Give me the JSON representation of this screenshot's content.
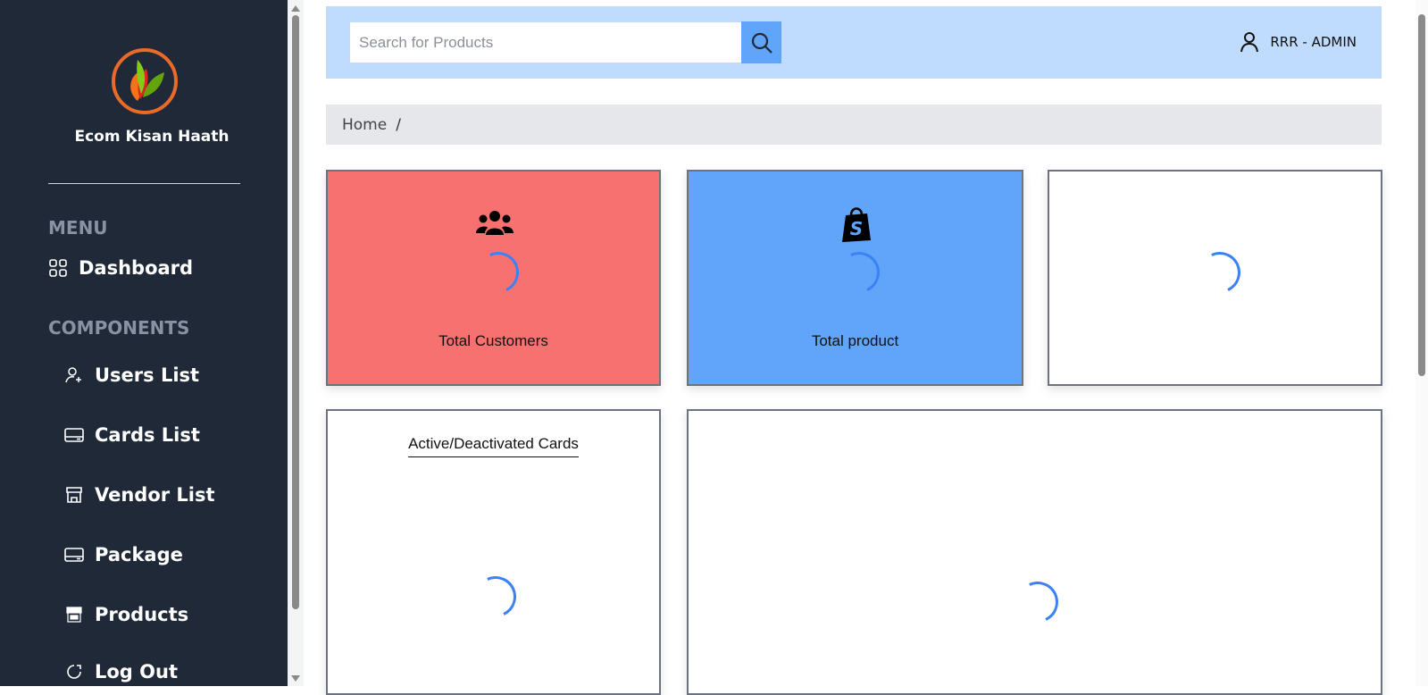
{
  "sidebar": {
    "brand": "Ecom Kisan Haath",
    "menu_label": "MENU",
    "components_label": "COMPONENTS",
    "items": [
      {
        "label": "Dashboard",
        "icon": "grid-icon"
      },
      {
        "label": "Users List",
        "icon": "user-add-icon"
      },
      {
        "label": "Cards List",
        "icon": "card-icon"
      },
      {
        "label": "Vendor List",
        "icon": "store-icon"
      },
      {
        "label": "Package",
        "icon": "card-icon"
      },
      {
        "label": "Products",
        "icon": "store-icon"
      },
      {
        "label": "Log Out",
        "icon": "logout-icon"
      }
    ]
  },
  "header": {
    "search_placeholder": "Search for Products",
    "user_label": "RRR - ADMIN"
  },
  "breadcrumb": {
    "home": "Home",
    "separator": "/"
  },
  "stats": [
    {
      "label": "Total Customers",
      "icon": "users-icon",
      "color": "#f87171"
    },
    {
      "label": "Total product",
      "icon": "shopify-bag-icon",
      "color": "#60a5fa"
    },
    {
      "label": "",
      "icon": "",
      "color": "#ffffff"
    }
  ],
  "panels": {
    "cards_chart_title": "Active/Deactivated Cards"
  },
  "colors": {
    "sidebar_bg": "#1f2937",
    "header_bg": "#bfdbfe",
    "accent": "#60a5fa",
    "spinner": "#3b82f6"
  }
}
